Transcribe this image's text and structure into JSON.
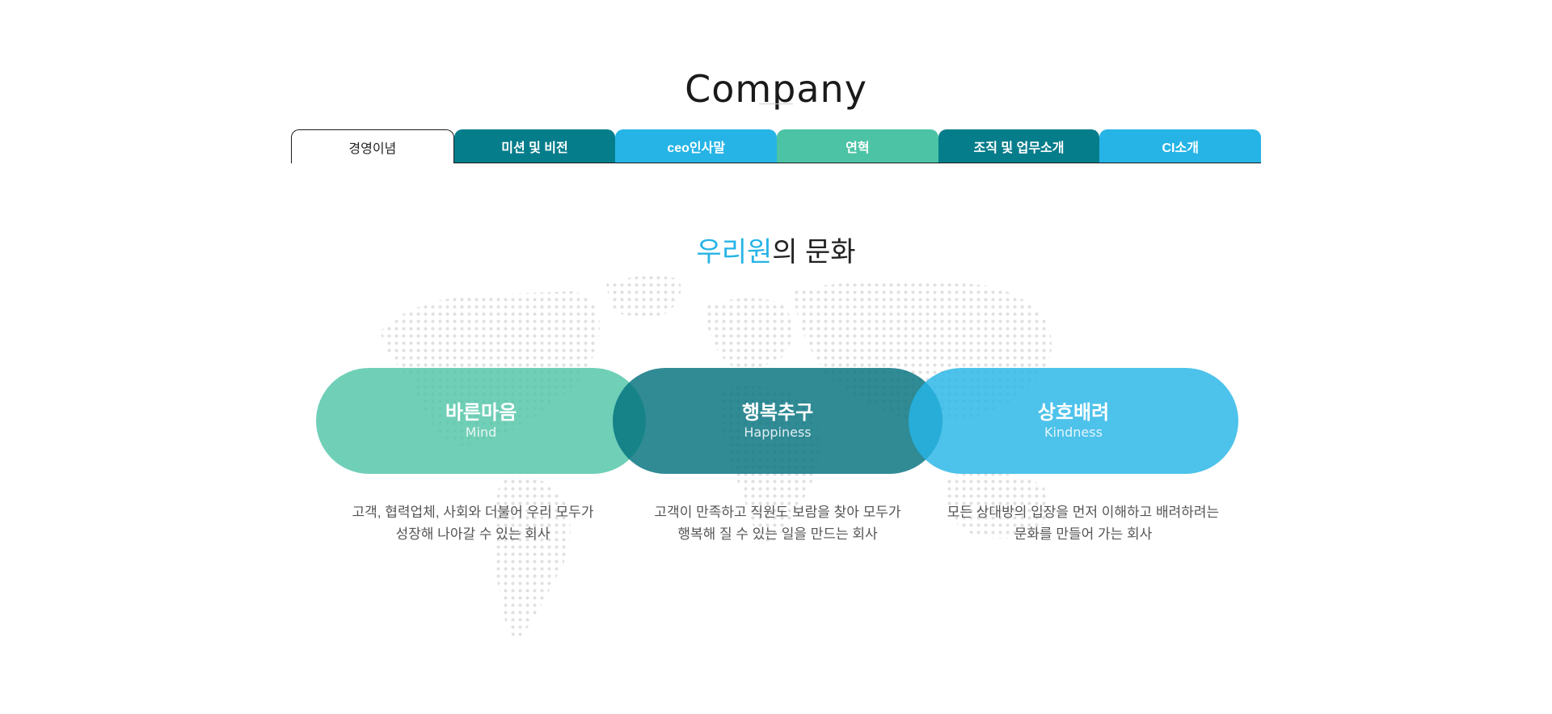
{
  "page": {
    "title": "Company"
  },
  "tabs": [
    {
      "label": "경영이념",
      "active": true,
      "color": "#ffffff"
    },
    {
      "label": "미션 및 비전",
      "active": false,
      "color": "#067d8b"
    },
    {
      "label": "ceo인사말",
      "active": false,
      "color": "#26b4e6"
    },
    {
      "label": "연혁",
      "active": false,
      "color": "#4cc3a5"
    },
    {
      "label": "조직 및 업무소개",
      "active": false,
      "color": "#067d8b"
    },
    {
      "label": "CI소개",
      "active": false,
      "color": "#26b4e6"
    }
  ],
  "section": {
    "heading_accent": "우리원",
    "heading_rest": "의 문화",
    "accent_color": "#26b4e6"
  },
  "values": [
    {
      "title": "바른마음",
      "subtitle": "Mind",
      "color": "#4cc3a5",
      "desc_line1": "고객, 협력업체, 사회와 더불어 우리 모두가",
      "desc_line2": "성장해 나아갈 수 있는 회사"
    },
    {
      "title": "행복추구",
      "subtitle": "Happiness",
      "color": "#03727e",
      "desc_line1": "고객이 만족하고 직원도 보람을 찾아 모두가",
      "desc_line2": "행복해 질 수 있는 일을 만드는 회사"
    },
    {
      "title": "상호배려",
      "subtitle": "Kindness",
      "color": "#26b4e6",
      "desc_line1": "모든 상대방의 입장을 먼저 이해하고 배려하려는",
      "desc_line2": "문화를 만들어 가는 회사"
    }
  ],
  "decor": {
    "background": "world-map-dots"
  }
}
